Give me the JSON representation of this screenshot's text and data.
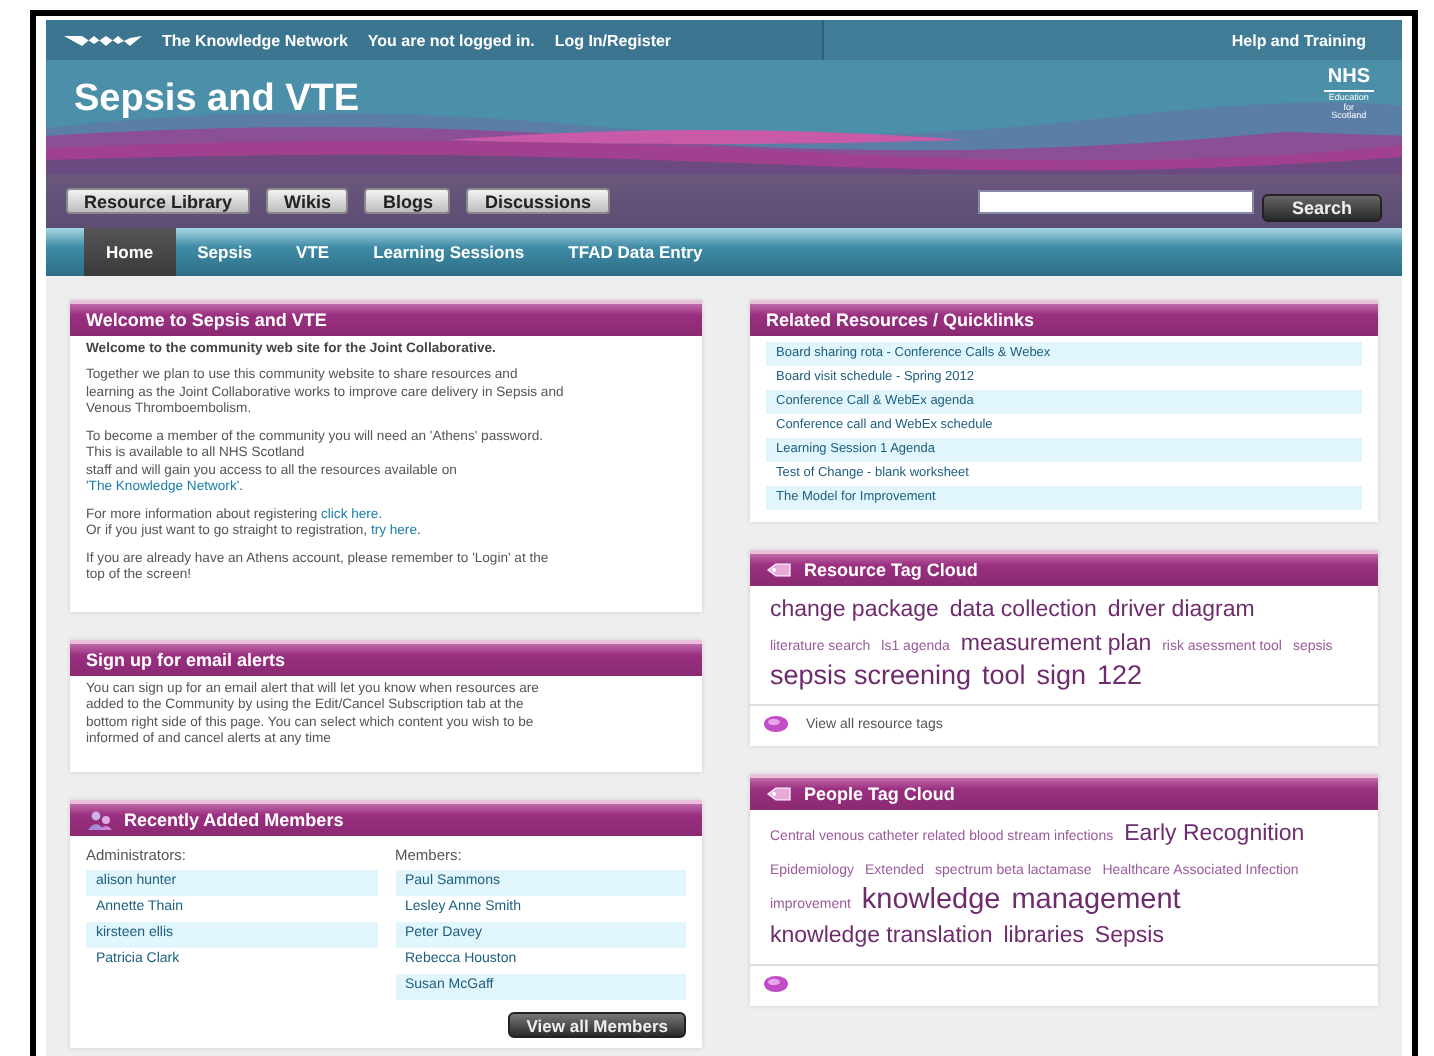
{
  "top_bar": {
    "site_name": "The Knowledge Network",
    "login_status": "You are not logged in.",
    "login_link": "Log In/Register",
    "help_link": "Help and Training"
  },
  "banner": {
    "title": "Sepsis and VTE",
    "logo": {
      "name": "NHS",
      "lines": [
        "Education",
        "for",
        "Scotland"
      ]
    }
  },
  "section_buttons": [
    "Resource Library",
    "Wikis",
    "Blogs",
    "Discussions"
  ],
  "search": {
    "button": "Search"
  },
  "nav_tabs": [
    {
      "label": "Home",
      "selected": true
    },
    {
      "label": "Sepsis",
      "selected": false
    },
    {
      "label": "VTE",
      "selected": false
    },
    {
      "label": "Learning Sessions",
      "selected": false
    },
    {
      "label": "TFAD Data Entry",
      "selected": false
    }
  ],
  "welcome": {
    "title": "Welcome to Sepsis and VTE",
    "paragraphs": [
      [
        {
          "text": "Welcome to the community web site for the Joint Collaborative.",
          "kind": "bold"
        }
      ],
      [
        {
          "text": "Together we plan to use this community website to share resources and\nlearning as the Joint Collaborative works to improve care delivery in Sepsis and\nVenous Thromboembolism.",
          "kind": "plain"
        }
      ],
      [
        {
          "text": "To become a member of the community you will need an 'Athens' password.\nThis is available to all NHS Scotland\nstaff and will gain you access to all the resources available on\n",
          "kind": "plain"
        },
        {
          "text": "'The Knowledge Network'",
          "kind": "link"
        },
        {
          "text": ".",
          "kind": "plain"
        }
      ],
      [
        {
          "text": "For more information about registering ",
          "kind": "plain"
        },
        {
          "text": "click here",
          "kind": "link"
        },
        {
          "text": ".\nOr if you just want to go straight to registration, ",
          "kind": "plain"
        },
        {
          "text": "try here",
          "kind": "link"
        },
        {
          "text": ".",
          "kind": "plain"
        }
      ],
      [
        {
          "text": "If you are already have an Athens account, please remember to 'Login' at the\ntop of the screen!",
          "kind": "plain"
        }
      ]
    ]
  },
  "email_alerts": {
    "title": "Sign up for email alerts",
    "text": "You can sign up for an email alert that will let you know when resources are\nadded to the Community by using the Edit/Cancel Subscription tab at the\nbottom right side of this page. You can select which content you wish to be\ninformed of and cancel alerts at any time"
  },
  "members": {
    "title": "Recently Added Members",
    "columns": [
      {
        "heading": "Administrators:",
        "names": [
          "alison hunter",
          "Annette Thain",
          "kirsteen ellis",
          "Patricia Clark"
        ]
      },
      {
        "heading": "Members:",
        "names": [
          "Paul Sammons",
          "Lesley Anne Smith",
          "Peter Davey",
          "Rebecca Houston",
          "Susan McGaff"
        ]
      }
    ],
    "button": "View all Members"
  },
  "quicklinks": {
    "title": "Related Resources / Quicklinks",
    "links": [
      "Board sharing rota - Conference Calls & Webex",
      "Board visit schedule - Spring 2012",
      "Conference Call & WebEx agenda",
      "Conference call and WebEx schedule",
      "Learning Session 1 Agenda",
      "Test of Change - blank worksheet",
      "The Model for Improvement"
    ]
  },
  "resource_tags": {
    "title": "Resource Tag Cloud",
    "tags": [
      {
        "text": "change package",
        "kind": "medium"
      },
      {
        "text": "data collection",
        "kind": "medium"
      },
      {
        "text": "driver diagram",
        "kind": "medium"
      },
      {
        "text": "literature search",
        "kind": "small"
      },
      {
        "text": "ls1 agenda",
        "kind": "small"
      },
      {
        "text": "measurement plan",
        "kind": "medium"
      },
      {
        "text": "risk asessment tool",
        "kind": "small"
      },
      {
        "text": "sepsis",
        "kind": "small"
      },
      {
        "text": "sepsis screening",
        "kind": "large"
      },
      {
        "text": "tool",
        "kind": "large"
      },
      {
        "text": "sign",
        "kind": "large"
      },
      {
        "text": "122",
        "kind": "large"
      }
    ],
    "footer_link": "View all resource tags"
  },
  "people_tags": {
    "title": "People Tag Cloud",
    "tags": [
      {
        "text": "Central venous catheter related blood stream infections",
        "kind": "small"
      },
      {
        "text": "Early Recognition",
        "kind": "medium"
      },
      {
        "text": "Epidemiology",
        "kind": "small"
      },
      {
        "text": "Extended",
        "kind": "small"
      },
      {
        "text": "spectrum beta lactamase",
        "kind": "small"
      },
      {
        "text": "Healthcare Associated Infection",
        "kind": "small"
      },
      {
        "text": "improvement",
        "kind": "small"
      },
      {
        "text": "knowledge",
        "kind": "xlarge"
      },
      {
        "text": "management",
        "kind": "xlarge"
      },
      {
        "text": "knowledge translation",
        "kind": "medium"
      },
      {
        "text": "libraries",
        "kind": "medium"
      },
      {
        "text": "Sepsis",
        "kind": "medium"
      }
    ]
  }
}
